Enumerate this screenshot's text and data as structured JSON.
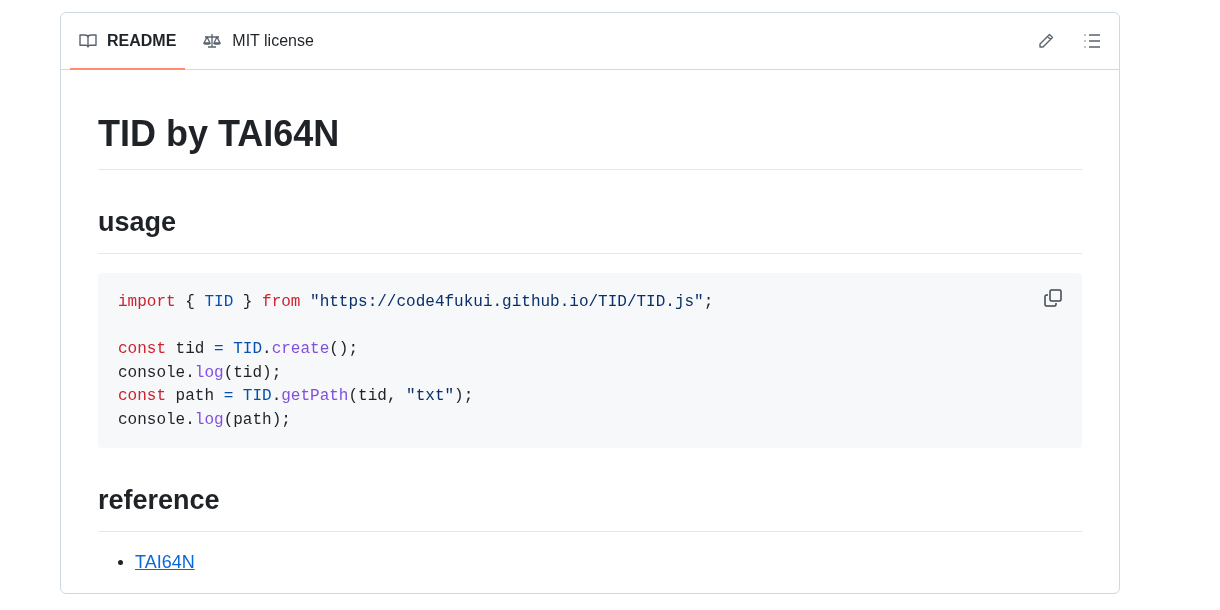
{
  "tabs": [
    {
      "label": "README",
      "selected": true
    },
    {
      "label": "MIT license",
      "selected": false
    }
  ],
  "title": "TID by TAI64N",
  "sections": [
    {
      "heading": "usage",
      "code": [
        [
          [
            {
              "kind": "keyword",
              "text": "import"
            },
            {
              "kind": "plain",
              "text": " { "
            },
            {
              "kind": "constant",
              "text": "TID"
            },
            {
              "kind": "plain",
              "text": " } "
            },
            {
              "kind": "keyword",
              "text": "from"
            },
            {
              "kind": "string",
              "text": " \"https://code4fukui.github.io/TID/TID.js\""
            },
            {
              "kind": "plain",
              "text": ";"
            }
          ]
        ],
        [
          [
            {
              "kind": "keyword",
              "text": "const"
            },
            {
              "kind": "plain",
              "text": " tid "
            },
            {
              "kind": "constant",
              "text": "= TID"
            },
            {
              "kind": "plain",
              "text": "."
            },
            {
              "kind": "function",
              "text": "create"
            },
            {
              "kind": "plain",
              "text": "();"
            }
          ],
          [
            {
              "kind": "plain",
              "text": "console."
            },
            {
              "kind": "function",
              "text": "log"
            },
            {
              "kind": "plain",
              "text": "(tid);"
            }
          ],
          [
            {
              "kind": "keyword",
              "text": "const"
            },
            {
              "kind": "plain",
              "text": " path "
            },
            {
              "kind": "constant",
              "text": "= TID"
            },
            {
              "kind": "plain",
              "text": "."
            },
            {
              "kind": "function",
              "text": "getPath"
            },
            {
              "kind": "plain",
              "text": "(tid, "
            },
            {
              "kind": "string",
              "text": "\"txt\""
            },
            {
              "kind": "plain",
              "text": ");"
            }
          ],
          [
            {
              "kind": "plain",
              "text": "console."
            },
            {
              "kind": "function",
              "text": "log"
            },
            {
              "kind": "plain",
              "text": "(path);"
            }
          ]
        ]
      ]
    },
    {
      "heading": "reference",
      "links": [
        "TAI64N"
      ]
    }
  ]
}
